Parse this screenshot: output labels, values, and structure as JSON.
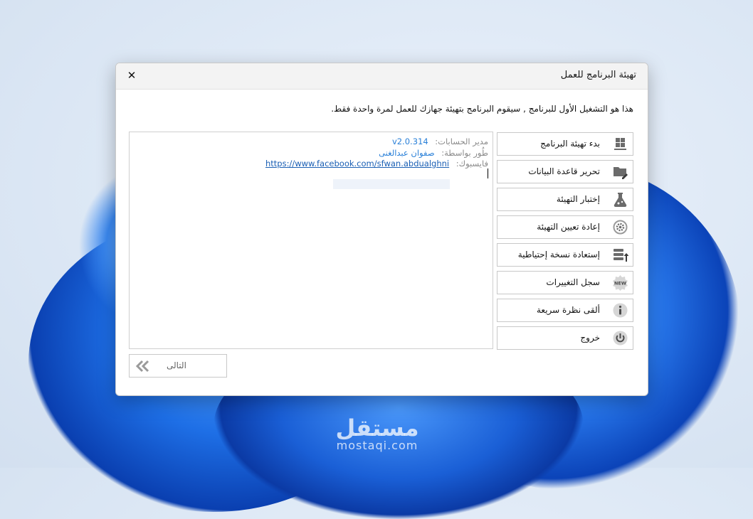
{
  "dialog": {
    "title": "تهيئة البرنامج للعمل",
    "close_label": "✕",
    "intro": "هذا هو التشغيل الأول للبرنامج , سيقوم البرنامج بتهيئة جهازك للعمل لمرة واحدة فقط."
  },
  "info": {
    "product_label": "مدير الحسابات:",
    "version": "v2.0.314",
    "developer_label": "طُور بواسطة:",
    "developer": "صفوان عبدالغنى",
    "facebook_label": "فايسبوك:",
    "facebook_url": "https://www.facebook.com/sfwan.abdualghni"
  },
  "menu": {
    "items": [
      {
        "label": "بدء تهيئة البرنامج",
        "icon": "windows-icon"
      },
      {
        "label": "تحرير قاعدة البيانات",
        "icon": "folder-edit-icon"
      },
      {
        "label": "إختبار التهيئة",
        "icon": "flask-icon"
      },
      {
        "label": "إعادة تعيين التهيئة",
        "icon": "gear-refresh-icon"
      },
      {
        "label": "إستعادة نسخة إحتياطية",
        "icon": "database-restore-icon"
      },
      {
        "label": "سجل التغييرات",
        "icon": "new-badge-icon"
      },
      {
        "label": "ألقى نظرة سريعة",
        "icon": "info-icon"
      },
      {
        "label": "خروج",
        "icon": "power-icon"
      }
    ]
  },
  "next_button": {
    "label": "التالى"
  },
  "watermark": {
    "arabic": "مستقل",
    "latin": "mostaqi.com"
  },
  "colors": {
    "accent_link": "#1a5fb4",
    "version_blue": "#2a80d8",
    "icon_gray": "#6b6b6b"
  }
}
